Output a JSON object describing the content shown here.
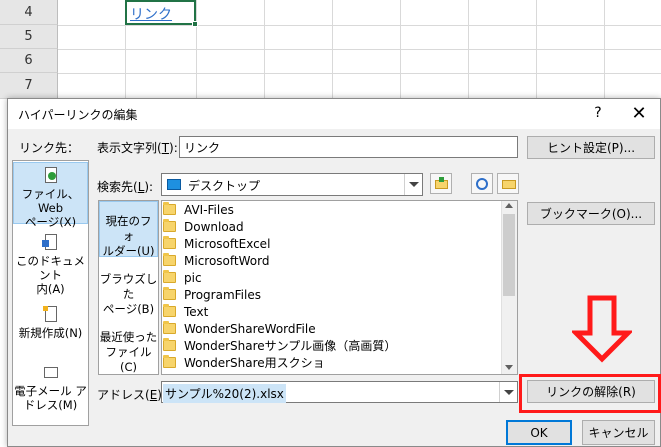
{
  "sheet": {
    "rows": [
      "4",
      "5",
      "6",
      "7"
    ],
    "cell_text": "リンク"
  },
  "dialog": {
    "title": "ハイパーリンクの編集",
    "help": "?",
    "close": "✕",
    "link_to_label": "リンク先：",
    "display_text_label": "表示文字列(",
    "display_text_key": "T",
    "display_text_close": "):",
    "display_text_value": "リンク",
    "screentip_button": "ヒント設定(P)...",
    "look_in_label": "検索先(",
    "look_in_key": "L",
    "look_in_close": "):",
    "look_in_value": "デスクトップ",
    "bookmark_button": "ブックマーク(O)...",
    "address_label": "アドレス(",
    "address_key": "E",
    "address_close": "):",
    "address_value": "サンプル%20(2).xlsx",
    "remove_link_button": "リンクの解除(R)",
    "ok_button": "OK",
    "cancel_button": "キャンセル"
  },
  "nav": [
    {
      "line1": "ファイル、Web",
      "line2": "ページ(X)",
      "icon": "web-page-icon",
      "active": true
    },
    {
      "line1": "このドキュメント",
      "line2": "内(A)",
      "icon": "document-icon",
      "active": false
    },
    {
      "line1": "新規作成(N)",
      "line2": "",
      "icon": "new-document-icon",
      "active": false
    },
    {
      "line1": "電子メール ア",
      "line2": "ドレス(M)",
      "icon": "email-icon",
      "active": false
    }
  ],
  "subnav": [
    {
      "line1": "現在のフォ",
      "line2": "ルダー(U)",
      "active": true
    },
    {
      "line1": "ブラウズした",
      "line2": "ページ(B)",
      "active": false
    },
    {
      "line1": "最近使った",
      "line2": "ファイル(C)",
      "active": false
    }
  ],
  "files": [
    "AVI-Files",
    "Download",
    "MicrosoftExcel",
    "MicrosoftWord",
    "pic",
    "ProgramFiles",
    "Text",
    "WonderShareWordFile",
    "WonderShareサンプル画像（高画質）",
    "WonderShare用スクショ"
  ],
  "colors": {
    "highlight_frame": "#ff1a1a",
    "selection": "#cce4f7",
    "link": "#2e6fc9"
  }
}
